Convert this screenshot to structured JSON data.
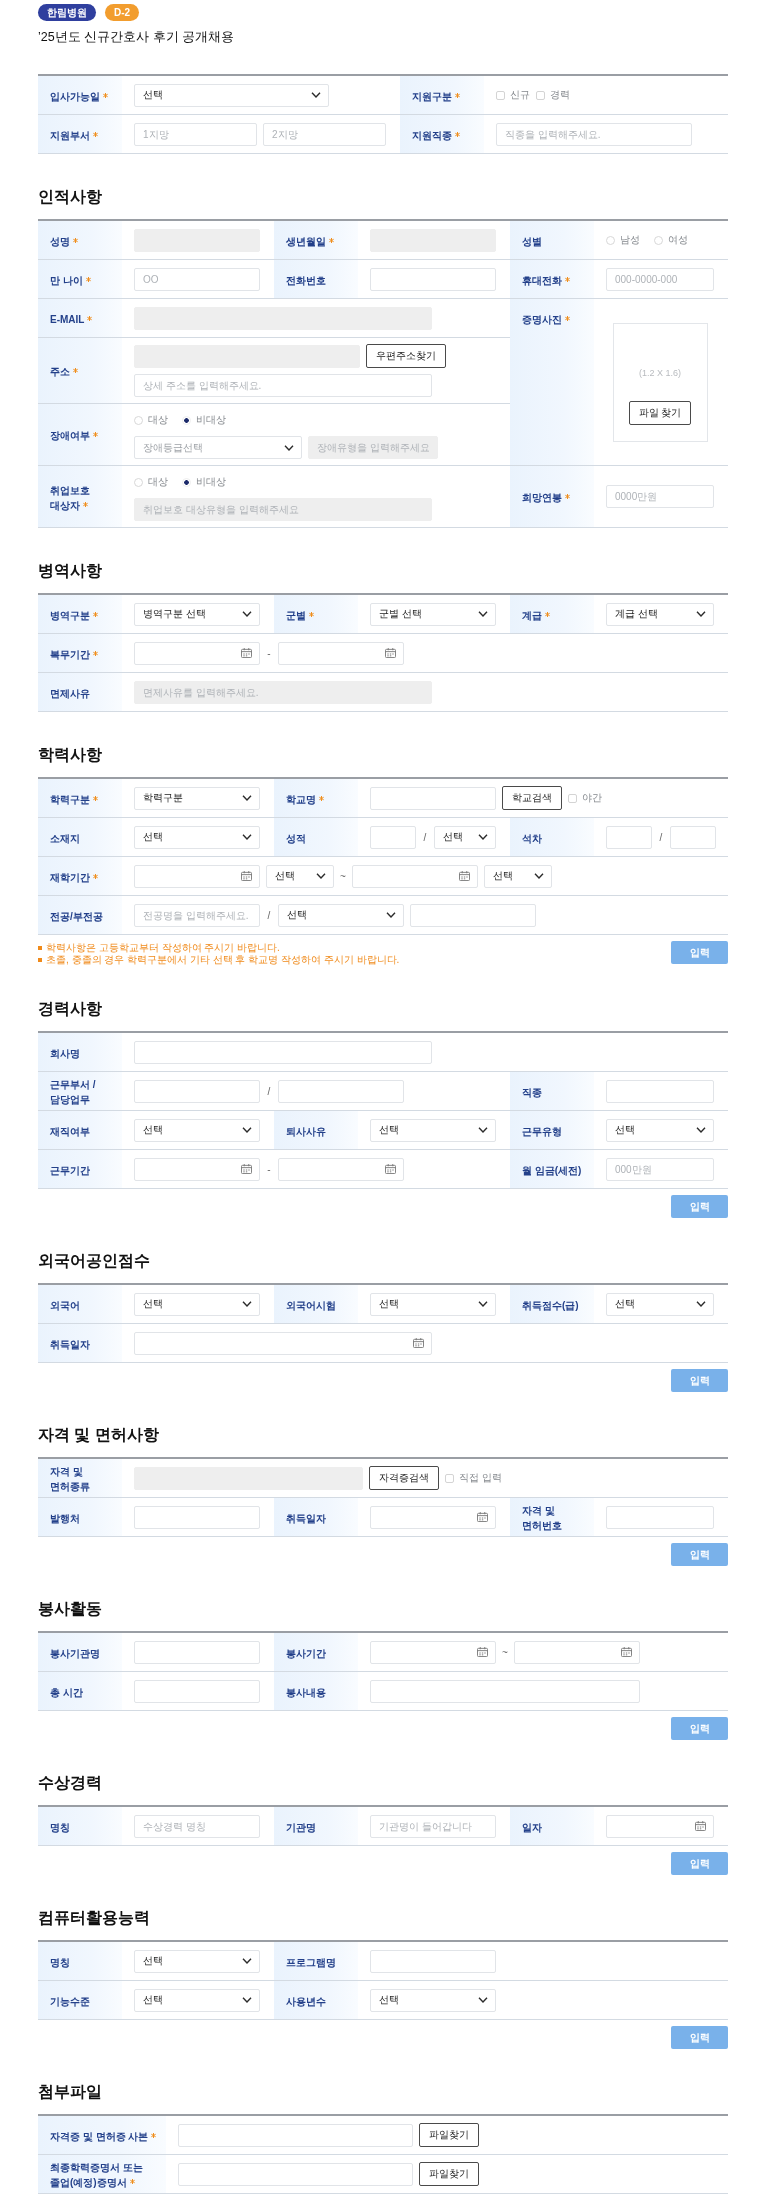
{
  "badges": [
    {
      "text": "한림병원",
      "color": "#2f3f9e"
    },
    {
      "text": "D-2",
      "color": "#f29d2e"
    }
  ],
  "title": "’25년도 신규간호사 후기 공개채용",
  "sections": [
    {
      "rows": [
        [
          {
            "label": "입사가능일",
            "required": true,
            "controls": [
              {
                "kind": "select",
                "value": "선택"
              }
            ]
          },
          {
            "label": "지원구분",
            "required": true,
            "controls": [
              {
                "kind": "checkbox",
                "label": "신규",
                "checked": false
              },
              {
                "kind": "checkbox",
                "label": "경력",
                "checked": false
              }
            ]
          }
        ],
        [
          {
            "label": "지원부서",
            "required": true,
            "controls": [
              {
                "kind": "input",
                "placeholder": "1지망",
                "disabled": false
              },
              {
                "kind": "input",
                "placeholder": "2지망",
                "disabled": false
              }
            ]
          },
          {
            "label": "지원직종",
            "required": true,
            "controls": [
              {
                "kind": "input",
                "placeholder": "직종을 입력해주세요.",
                "disabled": false
              }
            ]
          }
        ]
      ]
    },
    {
      "heading": "인적사항",
      "rows": [
        [
          {
            "label": "성명",
            "required": true,
            "controls": [
              {
                "kind": "input",
                "disabled": true
              }
            ]
          },
          {
            "label": "생년월일",
            "required": true,
            "controls": [
              {
                "kind": "input",
                "disabled": true
              }
            ]
          },
          {
            "label": "성별",
            "required": false,
            "controls": [
              {
                "kind": "radios",
                "options": [
                  {
                    "label": "남성",
                    "selected": false
                  },
                  {
                    "label": "여성",
                    "selected": false
                  }
                ]
              }
            ]
          }
        ],
        [
          {
            "label": "만 나이",
            "required": true,
            "controls": [
              {
                "kind": "input",
                "placeholder": "OO",
                "disabled": false
              }
            ]
          },
          {
            "label": "전화번호",
            "required": false,
            "controls": [
              {
                "kind": "input",
                "disabled": false
              }
            ]
          },
          {
            "label": "휴대전화",
            "required": true,
            "controls": [
              {
                "kind": "input",
                "placeholder": "000-0000-000",
                "disabled": false
              }
            ]
          }
        ],
        [
          {
            "label": "E-MAIL",
            "required": true,
            "controls": [
              {
                "kind": "input",
                "disabled": true
              }
            ]
          },
          {
            "label": "증명사진",
            "required": true,
            "controls": [
              {
                "kind": "photo",
                "caption": "(1.2 X 1.6)",
                "button": "파일 찾기"
              }
            ]
          }
        ],
        [
          {
            "label": "주소",
            "required": true,
            "lines": [
              [
                {
                  "kind": "input",
                  "disabled": true
                },
                {
                  "kind": "button",
                  "text": "우편주소찾기"
                }
              ],
              [
                {
                  "kind": "input",
                  "placeholder": "상세 주소를 입력해주세요.",
                  "disabled": false
                }
              ]
            ]
          }
        ],
        [
          {
            "label": "장애여부",
            "required": true,
            "lines": [
              [
                {
                  "kind": "radios",
                  "options": [
                    {
                      "label": "대상",
                      "selected": false
                    },
                    {
                      "label": "비대상",
                      "selected": true
                    }
                  ]
                }
              ],
              [
                {
                  "kind": "select",
                  "placeholder": "장애등급선택"
                },
                {
                  "kind": "input",
                  "placeholder": "장애유형을 입력해주세요",
                  "disabled": true
                }
              ]
            ]
          }
        ],
        [
          {
            "label": "취업보호 대상자",
            "required": true,
            "lines": [
              [
                {
                  "kind": "radios",
                  "options": [
                    {
                      "label": "대상",
                      "selected": false
                    },
                    {
                      "label": "비대상",
                      "selected": true
                    }
                  ]
                }
              ],
              [
                {
                  "kind": "input",
                  "placeholder": "취업보호 대상유형을 입력해주세요",
                  "disabled": true
                }
              ]
            ]
          },
          {
            "label": "희망연봉",
            "required": true,
            "controls": [
              {
                "kind": "input",
                "placeholder": "0000만원",
                "disabled": false
              }
            ]
          }
        ]
      ]
    },
    {
      "heading": "병역사항",
      "rows": [
        [
          {
            "label": "병역구분",
            "required": true,
            "controls": [
              {
                "kind": "select",
                "value": "병역구분 선택"
              }
            ]
          },
          {
            "label": "군별",
            "required": true,
            "controls": [
              {
                "kind": "select",
                "value": "군별 선택"
              }
            ]
          },
          {
            "label": "계급",
            "required": true,
            "controls": [
              {
                "kind": "select",
                "value": "계급 선택"
              }
            ]
          }
        ],
        [
          {
            "label": "복무기간",
            "required": true,
            "controls": [
              {
                "kind": "date"
              },
              {
                "kind": "text",
                "text": "-"
              },
              {
                "kind": "date"
              }
            ]
          }
        ],
        [
          {
            "label": "면제사유",
            "required": false,
            "controls": [
              {
                "kind": "input",
                "placeholder": "면제사유를 입력해주세요.",
                "disabled": true
              }
            ]
          }
        ]
      ]
    },
    {
      "heading": "학력사항",
      "rows": [
        [
          {
            "label": "학력구분",
            "required": true,
            "controls": [
              {
                "kind": "select",
                "value": "학력구분"
              }
            ]
          },
          {
            "label": "학교명",
            "required": true,
            "controls": [
              {
                "kind": "input",
                "disabled": false
              },
              {
                "kind": "button",
                "text": "학교검색"
              },
              {
                "kind": "checkbox",
                "label": "야간",
                "checked": false
              }
            ]
          }
        ],
        [
          {
            "label": "소재지",
            "required": false,
            "controls": [
              {
                "kind": "select",
                "value": "선택"
              }
            ]
          },
          {
            "label": "성적",
            "required": false,
            "controls": [
              {
                "kind": "input",
                "disabled": false
              },
              {
                "kind": "text",
                "text": "/"
              },
              {
                "kind": "select",
                "value": "선택"
              }
            ]
          },
          {
            "label": "석차",
            "required": false,
            "controls": [
              {
                "kind": "input",
                "disabled": false
              },
              {
                "kind": "text",
                "text": "/"
              },
              {
                "kind": "input",
                "disabled": false
              }
            ]
          }
        ],
        [
          {
            "label": "재학기간",
            "required": true,
            "controls": [
              {
                "kind": "date"
              },
              {
                "kind": "select",
                "value": "선택"
              },
              {
                "kind": "text",
                "text": "~"
              },
              {
                "kind": "date"
              },
              {
                "kind": "select",
                "value": "선택"
              }
            ]
          }
        ],
        [
          {
            "label": "전공/부전공",
            "required": false,
            "controls": [
              {
                "kind": "input",
                "placeholder": "전공명을 입력해주세요.",
                "disabled": false
              },
              {
                "kind": "text",
                "text": "/"
              },
              {
                "kind": "select",
                "value": "선택"
              },
              {
                "kind": "input",
                "disabled": false
              }
            ]
          }
        ]
      ],
      "notes": [
        "학력사항은 고등학교부터 작성하여 주시기 바랍니다.",
        "초졸, 중졸의 경우 학력구분에서 기타 선택 후 학교명 작성하여 주시기 바랍니다."
      ],
      "submit": "입력"
    },
    {
      "heading": "경력사항",
      "rows": [
        [
          {
            "label": "회사명",
            "required": false,
            "controls": [
              {
                "kind": "input",
                "disabled": false
              }
            ]
          }
        ],
        [
          {
            "label": "근무부서 / 담당업무",
            "required": false,
            "controls": [
              {
                "kind": "input",
                "disabled": false
              },
              {
                "kind": "text",
                "text": "/"
              },
              {
                "kind": "input",
                "disabled": false
              }
            ]
          },
          {
            "label": "직종",
            "required": false,
            "controls": [
              {
                "kind": "input",
                "disabled": false
              }
            ]
          }
        ],
        [
          {
            "label": "재직여부",
            "required": false,
            "controls": [
              {
                "kind": "select",
                "value": "선택"
              }
            ]
          },
          {
            "label": "퇴사사유",
            "required": false,
            "controls": [
              {
                "kind": "select",
                "value": "선택"
              }
            ]
          },
          {
            "label": "근무유형",
            "required": false,
            "controls": [
              {
                "kind": "select",
                "value": "선택"
              }
            ]
          }
        ],
        [
          {
            "label": "근무기간",
            "required": false,
            "controls": [
              {
                "kind": "date"
              },
              {
                "kind": "text",
                "text": "-"
              },
              {
                "kind": "date"
              }
            ]
          },
          {
            "label": "월 임금(세전)",
            "required": false,
            "controls": [
              {
                "kind": "input",
                "placeholder": "000만원",
                "disabled": false
              }
            ]
          }
        ]
      ],
      "submit": "입력"
    },
    {
      "heading": "외국어공인점수",
      "rows": [
        [
          {
            "label": "외국어",
            "required": false,
            "controls": [
              {
                "kind": "select",
                "value": "선택"
              }
            ]
          },
          {
            "label": "외국어시험",
            "required": false,
            "controls": [
              {
                "kind": "select",
                "value": "선택"
              }
            ]
          },
          {
            "label": "취득점수(급)",
            "required": false,
            "controls": [
              {
                "kind": "select",
                "value": "선택"
              }
            ]
          }
        ],
        [
          {
            "label": "취득일자",
            "required": false,
            "controls": [
              {
                "kind": "date"
              }
            ]
          }
        ]
      ],
      "submit": "입력"
    },
    {
      "heading": "자격 및 면허사항",
      "rows": [
        [
          {
            "label": "자격 및 면허종류",
            "required": false,
            "controls": [
              {
                "kind": "input",
                "disabled": true
              },
              {
                "kind": "button",
                "text": "자격증검색"
              },
              {
                "kind": "checkbox",
                "label": "직접 입력",
                "checked": false
              }
            ]
          }
        ],
        [
          {
            "label": "발행처",
            "required": false,
            "controls": [
              {
                "kind": "input",
                "disabled": false
              }
            ]
          },
          {
            "label": "취득일자",
            "required": false,
            "controls": [
              {
                "kind": "date"
              }
            ]
          },
          {
            "label": "자격 및 면허번호",
            "required": false,
            "controls": [
              {
                "kind": "input",
                "disabled": false
              }
            ]
          }
        ]
      ],
      "submit": "입력"
    },
    {
      "heading": "봉사활동",
      "rows": [
        [
          {
            "label": "봉사기관명",
            "required": false,
            "controls": [
              {
                "kind": "input",
                "disabled": false
              }
            ]
          },
          {
            "label": "봉사기간",
            "required": false,
            "controls": [
              {
                "kind": "date"
              },
              {
                "kind": "text",
                "text": "~"
              },
              {
                "kind": "date"
              }
            ]
          }
        ],
        [
          {
            "label": "총 시간",
            "required": false,
            "controls": [
              {
                "kind": "input",
                "disabled": false
              }
            ]
          },
          {
            "label": "봉사내용",
            "required": false,
            "controls": [
              {
                "kind": "input",
                "disabled": false
              }
            ]
          }
        ]
      ],
      "submit": "입력"
    },
    {
      "heading": "수상경력",
      "rows": [
        [
          {
            "label": "명칭",
            "required": false,
            "controls": [
              {
                "kind": "input",
                "placeholder": "수상경력 명칭",
                "disabled": false
              }
            ]
          },
          {
            "label": "기관명",
            "required": false,
            "controls": [
              {
                "kind": "input",
                "placeholder": "기관명이 들어갑니다",
                "disabled": false
              }
            ]
          },
          {
            "label": "일자",
            "required": false,
            "controls": [
              {
                "kind": "date"
              }
            ]
          }
        ]
      ],
      "submit": "입력"
    },
    {
      "heading": "컴퓨터활용능력",
      "rows": [
        [
          {
            "label": "명칭",
            "required": false,
            "controls": [
              {
                "kind": "select",
                "value": "선택"
              }
            ]
          },
          {
            "label": "프로그램명",
            "required": false,
            "controls": [
              {
                "kind": "input",
                "disabled": false
              }
            ]
          }
        ],
        [
          {
            "label": "기능수준",
            "required": false,
            "controls": [
              {
                "kind": "select",
                "value": "선택"
              }
            ]
          },
          {
            "label": "사용년수",
            "required": false,
            "controls": [
              {
                "kind": "select",
                "value": "선택"
              }
            ]
          }
        ]
      ],
      "submit": "입력"
    },
    {
      "heading": "첨부파일",
      "rows": [
        [
          {
            "label": "자격증 및 면허증 사본",
            "required": true,
            "controls": [
              {
                "kind": "input",
                "disabled": false
              },
              {
                "kind": "button",
                "text": "파일찾기"
              }
            ]
          }
        ],
        [
          {
            "label": "최종학력증명서 또는 졸업(예정)증명서",
            "required": true,
            "controls": [
              {
                "kind": "input",
                "disabled": false
              },
              {
                "kind": "button",
                "text": "파일찾기"
              }
            ]
          }
        ]
      ]
    }
  ]
}
